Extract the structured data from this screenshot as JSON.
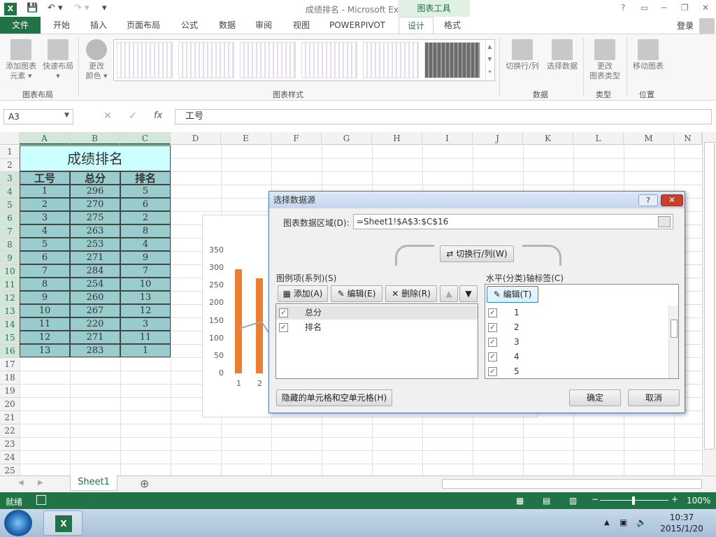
{
  "window": {
    "title": "成绩排名 - Microsoft Excel",
    "context_tab": "图表工具",
    "help": "?",
    "restore": "▭",
    "minimize": "─",
    "maximize": "❐",
    "close": "✕"
  },
  "tabs": {
    "file": "文件",
    "items": [
      "开始",
      "插入",
      "页面布局",
      "公式",
      "数据",
      "审阅",
      "视图",
      "POWERPIVOT",
      "设计",
      "格式"
    ],
    "login": "登录"
  },
  "ribbon": {
    "add_element": "添加图表\n元素 ▾",
    "quick_layout": "快速布局\n▾",
    "change_color": "更改\n颜色 ▾",
    "switch_row_col": "切换行/列",
    "select_data": "选择数据",
    "change_type": "更改\n图表类型",
    "move_chart": "移动图表",
    "groups": {
      "layout": "图表布局",
      "styles": "图表样式",
      "data": "数据",
      "type": "类型",
      "location": "位置"
    }
  },
  "formula_bar": {
    "namebox": "A3",
    "cancel": "✕",
    "enter": "✓",
    "fx": "fx",
    "value": "工号"
  },
  "columns": [
    "A",
    "B",
    "C",
    "D",
    "E",
    "F",
    "G",
    "H",
    "I",
    "J",
    "K",
    "L",
    "M",
    "N"
  ],
  "rows": [
    "1",
    "2",
    "3",
    "4",
    "5",
    "6",
    "7",
    "8",
    "9",
    "10",
    "11",
    "12",
    "13",
    "14",
    "15",
    "16",
    "17",
    "18",
    "19",
    "20",
    "21",
    "22",
    "23",
    "24",
    "25"
  ],
  "sheet": {
    "title": "成绩排名",
    "headers": [
      "工号",
      "总分",
      "排名"
    ],
    "data": [
      [
        "1",
        "296",
        "5"
      ],
      [
        "2",
        "270",
        "6"
      ],
      [
        "3",
        "275",
        "2"
      ],
      [
        "4",
        "263",
        "8"
      ],
      [
        "5",
        "253",
        "4"
      ],
      [
        "6",
        "271",
        "9"
      ],
      [
        "7",
        "284",
        "7"
      ],
      [
        "8",
        "254",
        "10"
      ],
      [
        "9",
        "260",
        "13"
      ],
      [
        "10",
        "267",
        "12"
      ],
      [
        "11",
        "220",
        "3"
      ],
      [
        "12",
        "271",
        "11"
      ],
      [
        "13",
        "283",
        "1"
      ]
    ]
  },
  "chart_data": {
    "type": "bar",
    "y_ticks": [
      "350",
      "300",
      "250",
      "200",
      "150",
      "100",
      "50",
      "0"
    ],
    "categories": [
      "1",
      "2"
    ],
    "ylim": [
      0,
      350
    ],
    "series": [
      {
        "values": [
          296,
          270
        ],
        "color": "#ed7d31"
      }
    ]
  },
  "sheet_tabs": {
    "active": "Sheet1",
    "add": "⊕"
  },
  "status": {
    "ready": "就绪",
    "zoom": "100%"
  },
  "taskbar": {
    "time": "10:37",
    "date": "2015/1/20"
  },
  "dialog": {
    "title": "选择数据源",
    "range_label": "图表数据区域(D):",
    "range_value": "=Sheet1!$A$3:$C$16",
    "switch_btn": "切换行/列(W)",
    "legend_label": "图例项(系列)(S)",
    "add_btn": "添加(A)",
    "edit_btn": "编辑(E)",
    "delete_btn": "删除(R)",
    "series": [
      {
        "name": "总分",
        "checked": "✓"
      },
      {
        "name": "排名",
        "checked": "✓"
      }
    ],
    "axis_label": "水平(分类)轴标签(C)",
    "axis_edit_btn": "编辑(T)",
    "axis_items": [
      "1",
      "2",
      "3",
      "4",
      "5"
    ],
    "hidden_btn": "隐藏的单元格和空单元格(H)",
    "ok": "确定",
    "cancel": "取消"
  }
}
